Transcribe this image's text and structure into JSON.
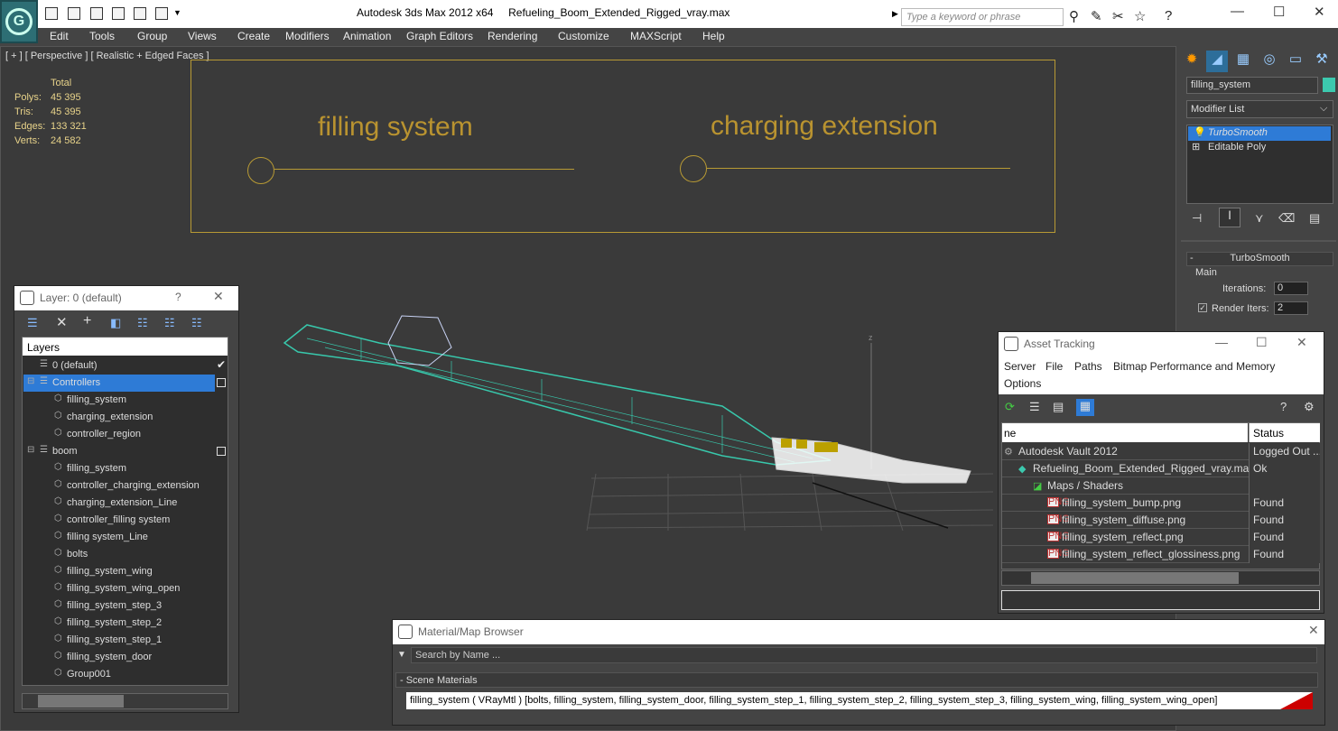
{
  "app": {
    "title": "Autodesk 3ds Max  2012 x64",
    "filename": "Refueling_Boom_Extended_Rigged_vray.max",
    "search_placeholder": "Type a keyword or phrase"
  },
  "menu": [
    "Edit",
    "Tools",
    "Group",
    "Views",
    "Create",
    "Modifiers",
    "Animation",
    "Graph Editors",
    "Rendering",
    "Customize",
    "MAXScript",
    "Help"
  ],
  "viewport": {
    "label": "[ + ] [ Perspective ] [ Realistic + Edged Faces ]",
    "stats_header": "Total",
    "stats": [
      {
        "label": "Polys:",
        "value": "45 395"
      },
      {
        "label": "Tris:",
        "value": "45 395"
      },
      {
        "label": "Edges:",
        "value": "133 321"
      },
      {
        "label": "Verts:",
        "value": "24 582"
      }
    ],
    "gizmo_left": "filling system",
    "gizmo_right": "charging extension",
    "axis_z": "z"
  },
  "command_panel": {
    "object_name": "filling_system",
    "modifier_list": "Modifier List",
    "stack": [
      "TurboSmooth",
      "Editable Poly"
    ],
    "rollout": "TurboSmooth",
    "group": "Main",
    "iterations_label": "Iterations:",
    "iterations": "0",
    "render_iters_label": "Render Iters:",
    "render_iters": "2"
  },
  "layer_window": {
    "title": "Layer: 0 (default)",
    "help": "?",
    "column": "Layers",
    "rows": [
      {
        "name": "0 (default)",
        "indent": 1
      },
      {
        "name": "Controllers",
        "indent": 1,
        "selected": true
      },
      {
        "name": "filling_system",
        "indent": 2
      },
      {
        "name": "charging_extension",
        "indent": 2
      },
      {
        "name": "controller_region",
        "indent": 2
      },
      {
        "name": "boom",
        "indent": 1
      },
      {
        "name": "filling_system",
        "indent": 2
      },
      {
        "name": "controller_charging_extension",
        "indent": 2
      },
      {
        "name": "charging_extension_Line",
        "indent": 2
      },
      {
        "name": "controller_filling system",
        "indent": 2
      },
      {
        "name": "filling system_Line",
        "indent": 2
      },
      {
        "name": "bolts",
        "indent": 2
      },
      {
        "name": "filling_system_wing",
        "indent": 2
      },
      {
        "name": "filling_system_wing_open",
        "indent": 2
      },
      {
        "name": "filling_system_step_3",
        "indent": 2
      },
      {
        "name": "filling_system_step_2",
        "indent": 2
      },
      {
        "name": "filling_system_step_1",
        "indent": 2
      },
      {
        "name": "filling_system_door",
        "indent": 2
      },
      {
        "name": "Group001",
        "indent": 2
      }
    ]
  },
  "asset_window": {
    "title": "Asset Tracking",
    "menu": [
      "Server",
      "File",
      "Paths",
      "Bitmap Performance and Memory",
      "Options"
    ],
    "col_name": "ne",
    "col_status": "Status",
    "rows": [
      {
        "name": "Autodesk Vault 2012",
        "status": "Logged Out ...",
        "indent": 0
      },
      {
        "name": "Refueling_Boom_Extended_Rigged_vray.max",
        "status": "Ok",
        "indent": 1
      },
      {
        "name": "Maps / Shaders",
        "status": "",
        "indent": 2
      },
      {
        "name": "filling_system_bump.png",
        "status": "Found",
        "indent": 3
      },
      {
        "name": "filling_system_diffuse.png",
        "status": "Found",
        "indent": 3
      },
      {
        "name": "filling_system_reflect.png",
        "status": "Found",
        "indent": 3
      },
      {
        "name": "filling_system_reflect_glossiness.png",
        "status": "Found",
        "indent": 3
      }
    ]
  },
  "material_window": {
    "title": "Material/Map Browser",
    "search_placeholder": "Search by Name ...",
    "section": "- Scene Materials",
    "material": "filling_system ( VRayMtl ) [bolts, filling_system, filling_system_door, filling_system_step_1, filling_system_step_2, filling_system_step_3, filling_system_wing, filling_system_wing_open]"
  },
  "colors": {
    "accent": "#3cc9ae",
    "gizmo": "#b89a34",
    "selection": "#2e7bd6"
  }
}
